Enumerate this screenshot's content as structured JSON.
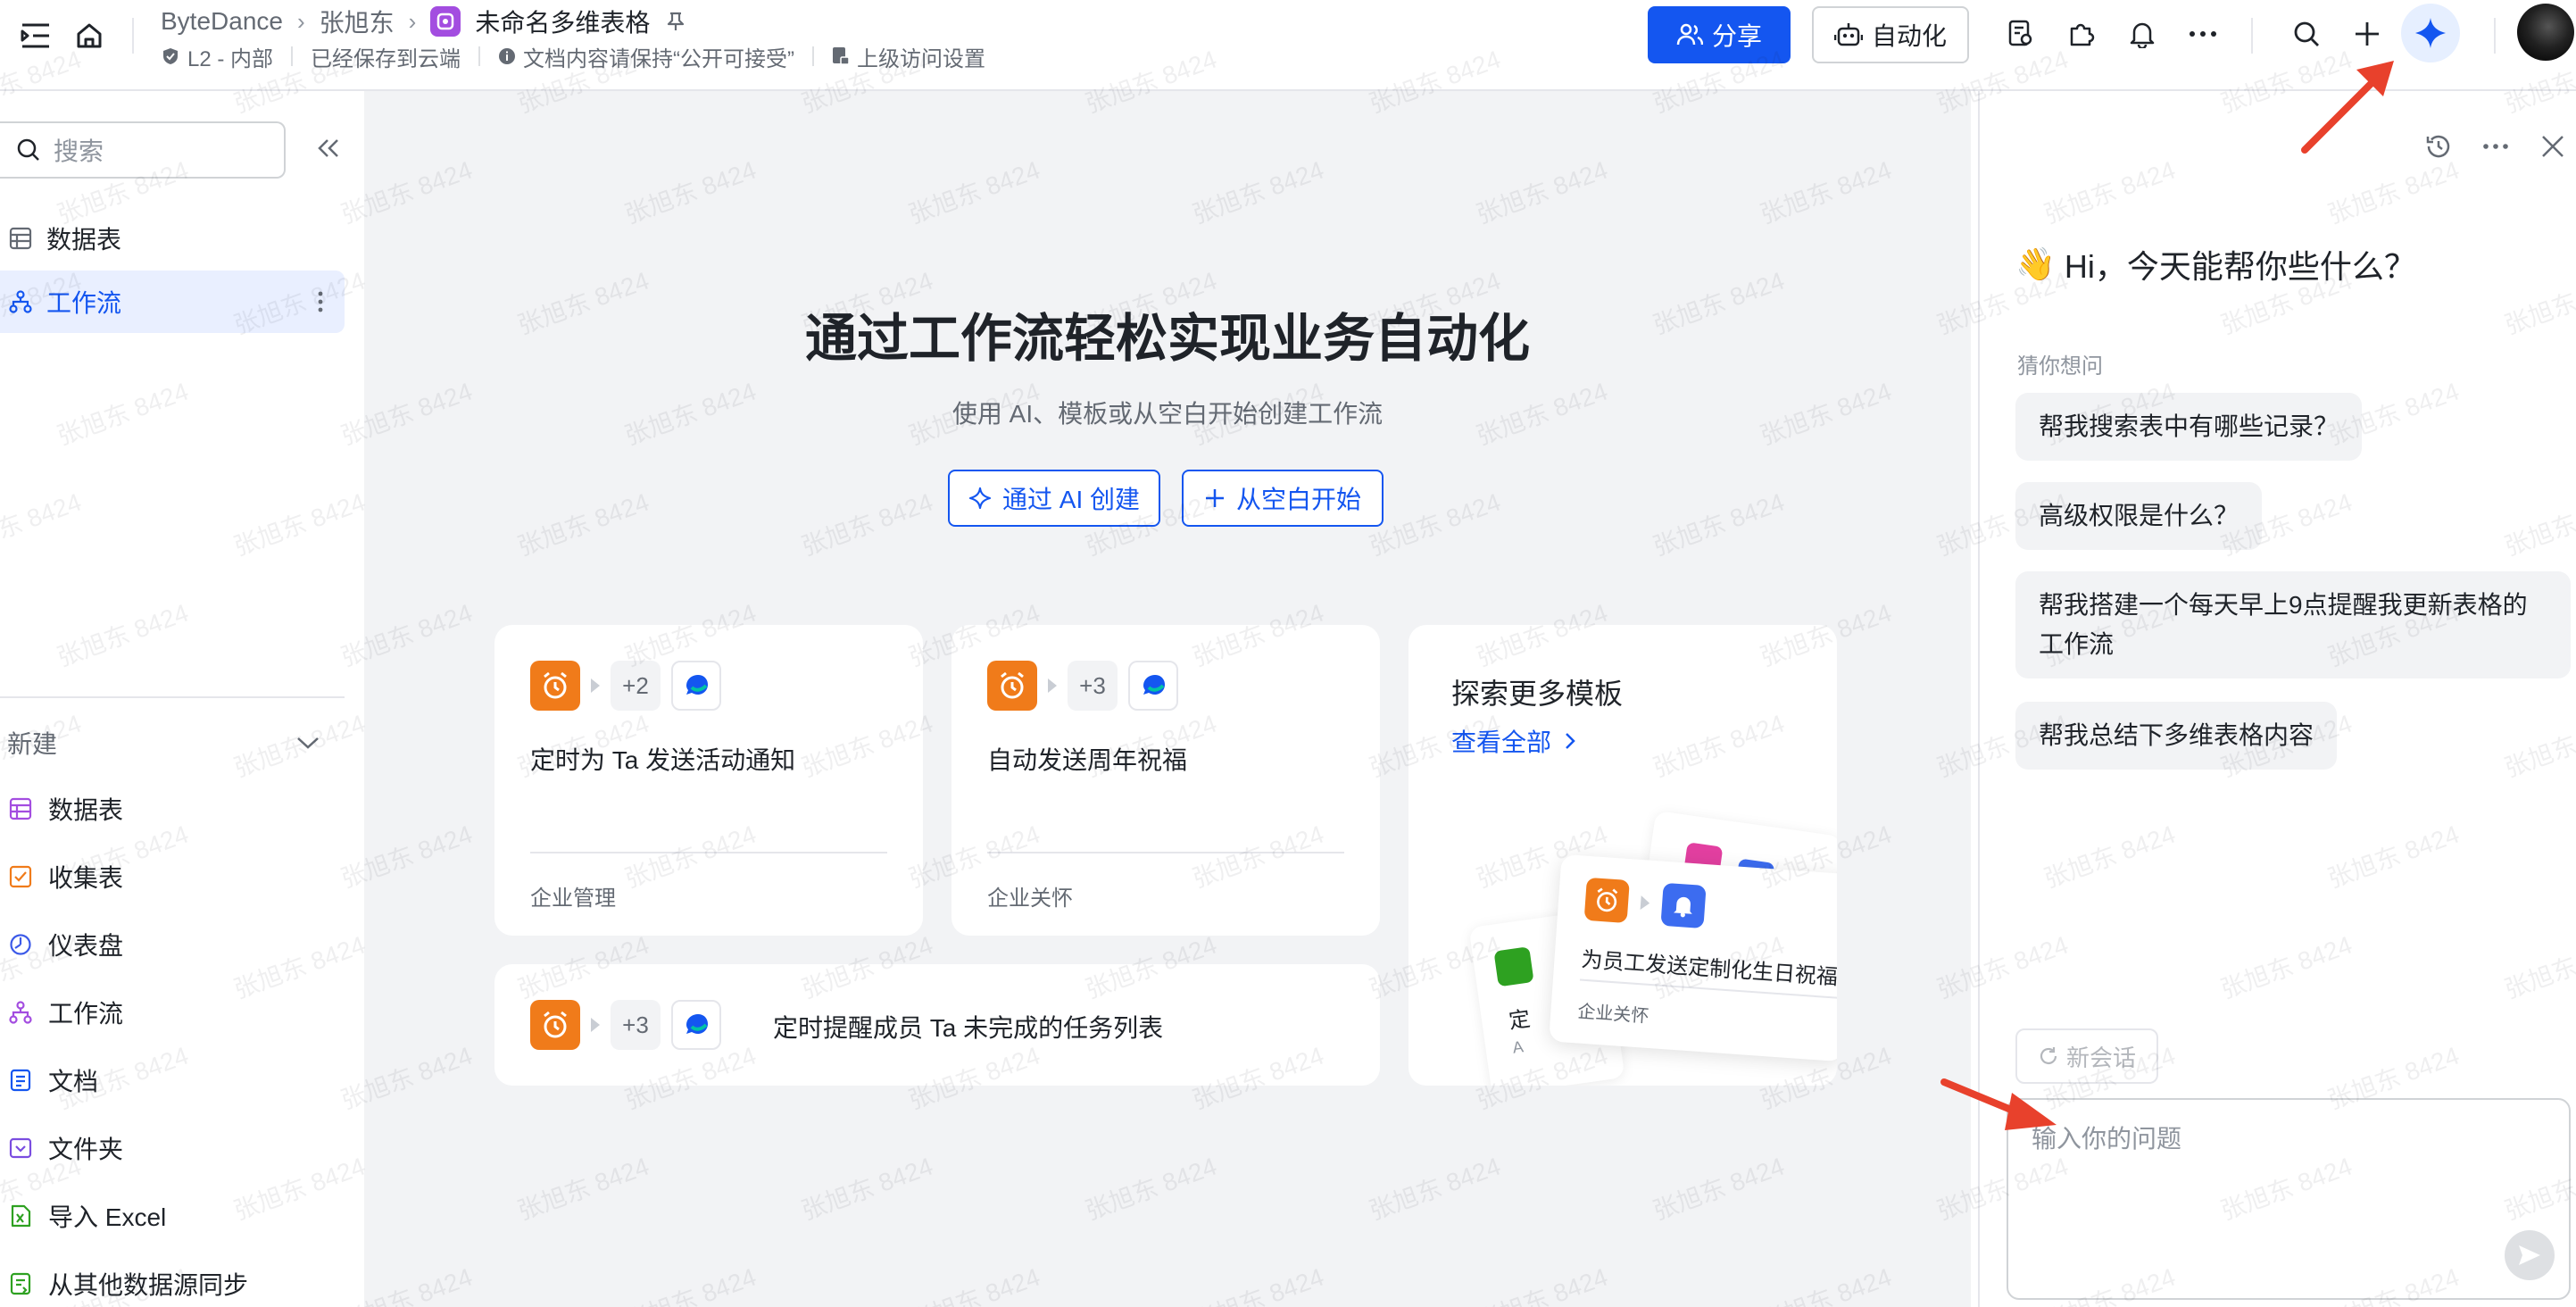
{
  "header": {
    "company": "ByteDance",
    "owner": "张旭东",
    "doc_title": "未命名多维表格",
    "security_level": "L2 - 内部",
    "save_status": "已经保存到云端",
    "content_notice": "文档内容请保持“公开可接受”",
    "access_setting": "上级访问设置",
    "share_label": "分享",
    "automation_label": "自动化"
  },
  "sidebar": {
    "search_placeholder": "搜索",
    "items": [
      {
        "label": "数据表",
        "icon": "table-icon"
      },
      {
        "label": "工作流",
        "icon": "workflow-icon",
        "active": true
      }
    ],
    "new_section_label": "新建",
    "new_items": [
      {
        "label": "数据表",
        "icon": "table-icon"
      },
      {
        "label": "收集表",
        "icon": "form-icon"
      },
      {
        "label": "仪表盘",
        "icon": "dashboard-icon"
      },
      {
        "label": "工作流",
        "icon": "workflow-icon"
      },
      {
        "label": "文档",
        "icon": "doc-icon"
      },
      {
        "label": "文件夹",
        "icon": "folder-icon"
      },
      {
        "label": "导入 Excel",
        "icon": "excel-icon"
      },
      {
        "label": "从其他数据源同步",
        "icon": "sync-icon"
      }
    ]
  },
  "main": {
    "title": "通过工作流轻松实现业务自动化",
    "subtitle": "使用 AI、模板或从空白开始创建工作流",
    "ai_create_label": "通过 AI 创建",
    "blank_start_label": "从空白开始",
    "templates": [
      {
        "title": "定时为 Ta 发送活动通知",
        "extra_steps": "+2",
        "tag": "企业管理"
      },
      {
        "title": "自动发送周年祝福",
        "extra_steps": "+3",
        "tag": "企业关怀"
      },
      {
        "title": "定时提醒成员 Ta 未完成的任务列表",
        "extra_steps": "+3"
      }
    ],
    "explore": {
      "title": "探索更多模板",
      "link": "查看全部",
      "preview_title": "为员工发送定制化生日祝福",
      "preview_tag": "企业关怀",
      "back_card_text": "定",
      "back_card_tag": "A"
    }
  },
  "assistant": {
    "greeting_emoji": "👋",
    "greeting": "Hi，今天能帮你些什么？",
    "guess_label": "猜你想问",
    "suggestions": [
      "帮我搜索表中有哪些记录？",
      "高级权限是什么？",
      "帮我搭建一个每天早上9点提醒我更新表格的工作流",
      "帮我总结下多维表格内容"
    ],
    "new_chat_label": "新会话",
    "input_placeholder": "输入你的问题"
  },
  "watermark": "张旭东 8424",
  "colors": {
    "brand_blue": "#1456f0",
    "doc_purple": "#a34de0",
    "clock_orange": "#f07b1a",
    "annotation_red": "#e8412c",
    "canvas_gray": "#f2f3f5"
  }
}
